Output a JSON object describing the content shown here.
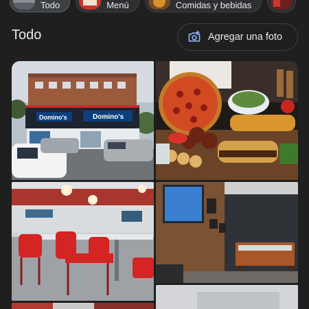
{
  "chips": [
    {
      "label": "Todo",
      "active": true
    },
    {
      "label": "Menú",
      "active": false
    },
    {
      "label": "Comidas y bebidas",
      "active": false
    },
    {
      "label": "",
      "active": false
    }
  ],
  "section": {
    "title": "Todo",
    "add_photo_label": "Agregar una foto",
    "add_photo_icon": "add-photo-camera-icon"
  },
  "photos": {
    "storefront": {
      "sign_text_1": "Domino's",
      "sign_text_2": "Domino's"
    }
  },
  "colors": {
    "background": "#1f1f1f",
    "accent": "#8ab4f8",
    "text": "#e8eaed"
  }
}
